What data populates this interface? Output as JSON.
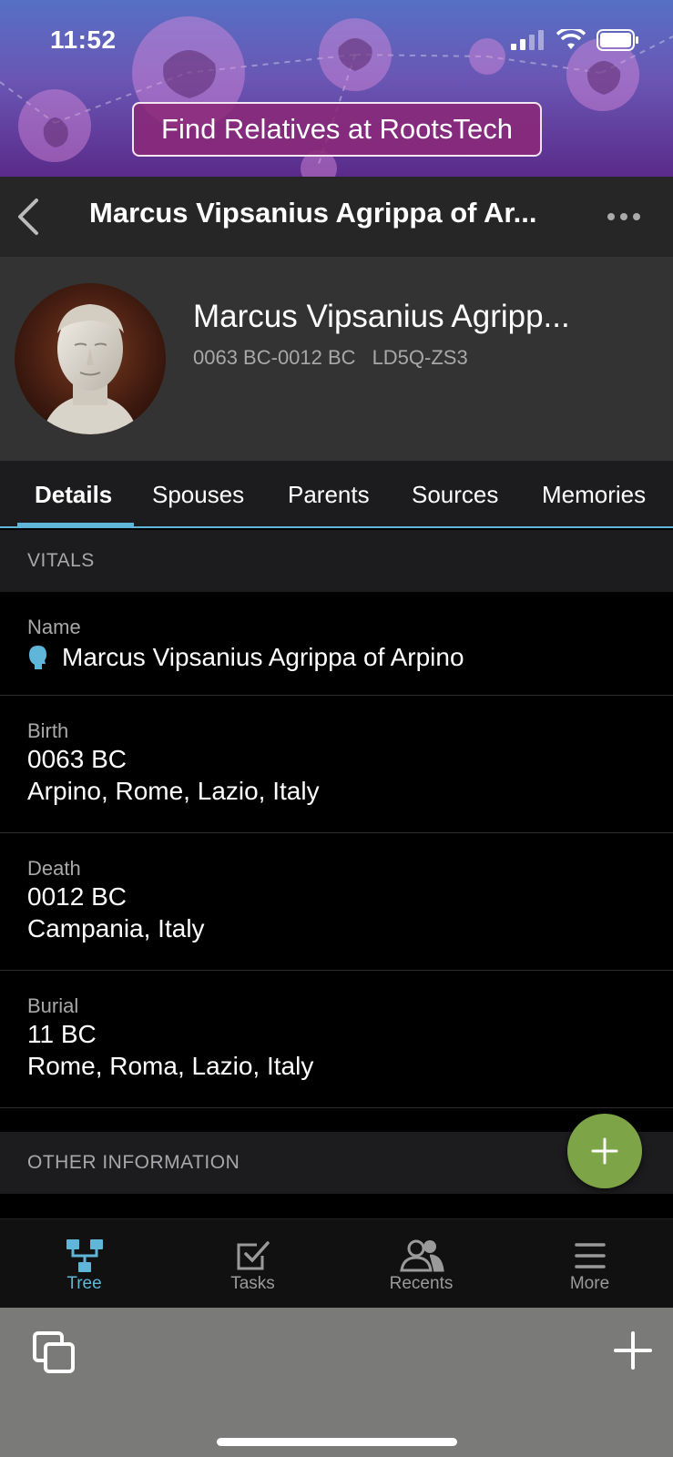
{
  "status_bar": {
    "time": "11:52"
  },
  "banner": {
    "button_label": "Find Relatives at RootsTech"
  },
  "nav": {
    "title": "Marcus Vipsanius Agrippa of Ar..."
  },
  "profile": {
    "name": "Marcus Vipsanius Agripp...",
    "lifespan": "0063 BC-0012 BC",
    "person_id": "LD5Q-ZS3"
  },
  "tabs": [
    {
      "label": "Details",
      "active": true
    },
    {
      "label": "Spouses",
      "active": false
    },
    {
      "label": "Parents",
      "active": false
    },
    {
      "label": "Sources",
      "active": false
    },
    {
      "label": "Memories",
      "active": false
    }
  ],
  "vitals": {
    "header": "VITALS",
    "name": {
      "label": "Name",
      "value": "Marcus Vipsanius Agrippa of Arpino"
    },
    "birth": {
      "label": "Birth",
      "date": "0063 BC",
      "place": "Arpino, Rome, Lazio, Italy"
    },
    "death": {
      "label": "Death",
      "date": "0012 BC",
      "place": "Campania, Italy"
    },
    "burial": {
      "label": "Burial",
      "date": "11 BC",
      "place": "Rome, Roma, Lazio, Italy"
    }
  },
  "other_info": {
    "header": "OTHER INFORMATION"
  },
  "bottom_tabs": [
    {
      "label": "Tree",
      "icon": "tree-icon",
      "active": true
    },
    {
      "label": "Tasks",
      "icon": "tasks-icon",
      "active": false
    },
    {
      "label": "Recents",
      "icon": "recents-icon",
      "active": false
    },
    {
      "label": "More",
      "icon": "menu-icon",
      "active": false
    }
  ],
  "colors": {
    "accent": "#5fb6d9",
    "fab": "#7da547",
    "banner_button": "#8c2878"
  }
}
